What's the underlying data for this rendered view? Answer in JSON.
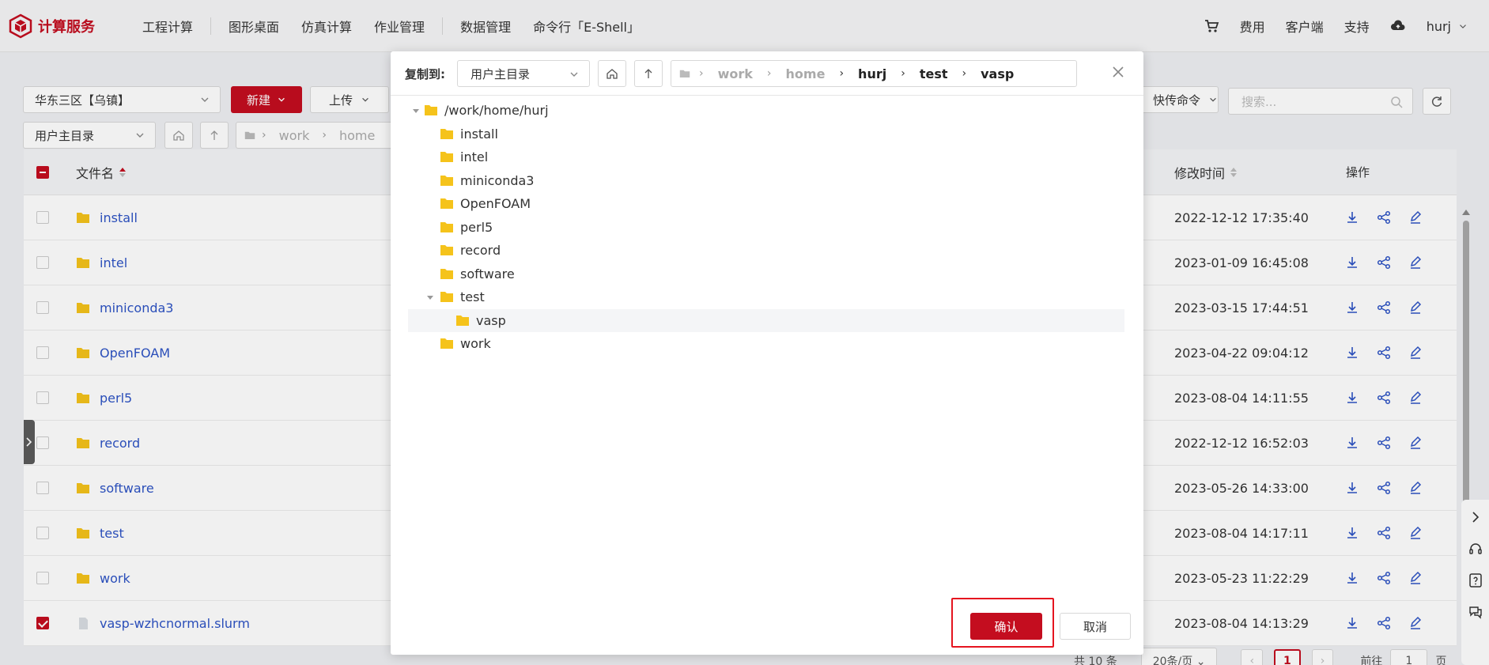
{
  "brand": {
    "name": "计算服务",
    "color": "#c40d1f"
  },
  "nav": {
    "items": [
      "工程计算",
      "图形桌面",
      "仿真计算",
      "作业管理",
      "数据管理",
      "命令行「E-Shell」"
    ]
  },
  "topright": {
    "fees": "费用",
    "client": "客户端",
    "support": "支持",
    "user": "hurj"
  },
  "toolbar": {
    "region": "华东三区【乌镇】",
    "new_label": "新建",
    "upload_label": "上传",
    "quick_cmd": "快传命令",
    "search_placeholder": "搜索...",
    "dir_select": "用户主目录",
    "path": [
      "work",
      "home"
    ]
  },
  "table": {
    "col_name": "文件名",
    "col_mtime": "修改时间",
    "col_ops": "操作",
    "rows": [
      {
        "name": "install",
        "mtime": "2022-12-12 17:35:40",
        "type": "folder",
        "checked": false
      },
      {
        "name": "intel",
        "mtime": "2023-01-09 16:45:08",
        "type": "folder",
        "checked": false
      },
      {
        "name": "miniconda3",
        "mtime": "2023-03-15 17:44:51",
        "type": "folder",
        "checked": false
      },
      {
        "name": "OpenFOAM",
        "mtime": "2023-04-22 09:04:12",
        "type": "folder",
        "checked": false
      },
      {
        "name": "perl5",
        "mtime": "2023-08-04 14:11:55",
        "type": "folder",
        "checked": false
      },
      {
        "name": "record",
        "mtime": "2022-12-12 16:52:03",
        "type": "folder",
        "checked": false
      },
      {
        "name": "software",
        "mtime": "2023-05-26 14:33:00",
        "type": "folder",
        "checked": false
      },
      {
        "name": "test",
        "mtime": "2023-08-04 14:17:11",
        "type": "folder",
        "checked": false
      },
      {
        "name": "work",
        "mtime": "2023-05-23 11:22:29",
        "type": "folder",
        "checked": false
      },
      {
        "name": "vasp-wzhcnormal.slurm",
        "mtime": "2023-08-04 14:13:29",
        "type": "file",
        "checked": true
      }
    ]
  },
  "footer": {
    "total": "共 10 条",
    "page_size": "20条/页",
    "current_page": "1",
    "goto_label": "前往",
    "goto_value": "1",
    "page_suffix": "页"
  },
  "dialog": {
    "label": "复制到:",
    "dir_select": "用户主目录",
    "path": [
      "work",
      "home",
      "hurj",
      "test",
      "vasp"
    ],
    "tree_root": "/work/home/hurj",
    "tree": [
      "install",
      "intel",
      "miniconda3",
      "OpenFOAM",
      "perl5",
      "record",
      "software",
      "test"
    ],
    "tree_child": "vasp",
    "tree_last": "work",
    "ok_label": "确认",
    "cancel_label": "取消"
  }
}
